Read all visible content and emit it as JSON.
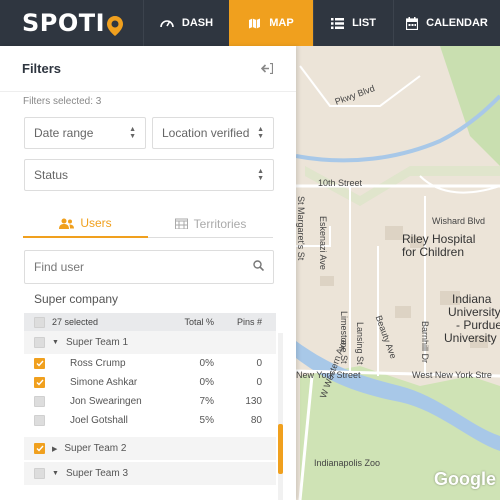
{
  "app": {
    "logo_text": "SPOTI"
  },
  "nav": {
    "dash": "DASH",
    "map": "MAP",
    "list": "LIST",
    "calendar": "CALENDAR"
  },
  "panel": {
    "title": "Filters",
    "selected_text": "Filters selected: 3",
    "date_range": "Date range",
    "location_verified": "Location verified",
    "status": "Status",
    "tab_users": "Users",
    "tab_territories": "Territories",
    "search_placeholder": "Find user",
    "company": "Super company"
  },
  "table": {
    "selected": "27 selected",
    "col_total": "Total %",
    "col_pins": "Pins #",
    "team1": "Super Team 1",
    "members": [
      {
        "name": "Ross Crump",
        "total": "0%",
        "pins": "0",
        "checked": true
      },
      {
        "name": "Simone Ashkar",
        "total": "0%",
        "pins": "0",
        "checked": true
      },
      {
        "name": "Jon Swearingen",
        "total": "7%",
        "pins": "130",
        "checked": false
      },
      {
        "name": "Joel Gotshall",
        "total": "5%",
        "pins": "80",
        "checked": false
      }
    ],
    "team2": "Super Team 2",
    "team3": "Super Team 3"
  },
  "map": {
    "labels": {
      "tenth": "10th Street",
      "wishard": "Wishard Blvd",
      "riley1": "Riley Hospital",
      "riley2": "for Children",
      "indiana1": "Indiana",
      "indiana2": "University",
      "indiana3": "- Purdue",
      "indiana4": "University",
      "new_york": "New York Street",
      "new_york2": "West New York Stre",
      "zoo": "Indianapolis Zoo",
      "pkwy": "Pkwy Blvd",
      "eskenazi": "Eskenazi Ave",
      "margarets": "St Margaret's St",
      "limestone": "Limestone St",
      "lansing": "Lansing St",
      "beauty": "Beauty Ave",
      "barnhill": "Barnhill Dr",
      "western": "W Western Ave",
      "google": "Google"
    }
  },
  "colors": {
    "accent": "#f0a01e",
    "nav_bg": "#2f3640"
  }
}
